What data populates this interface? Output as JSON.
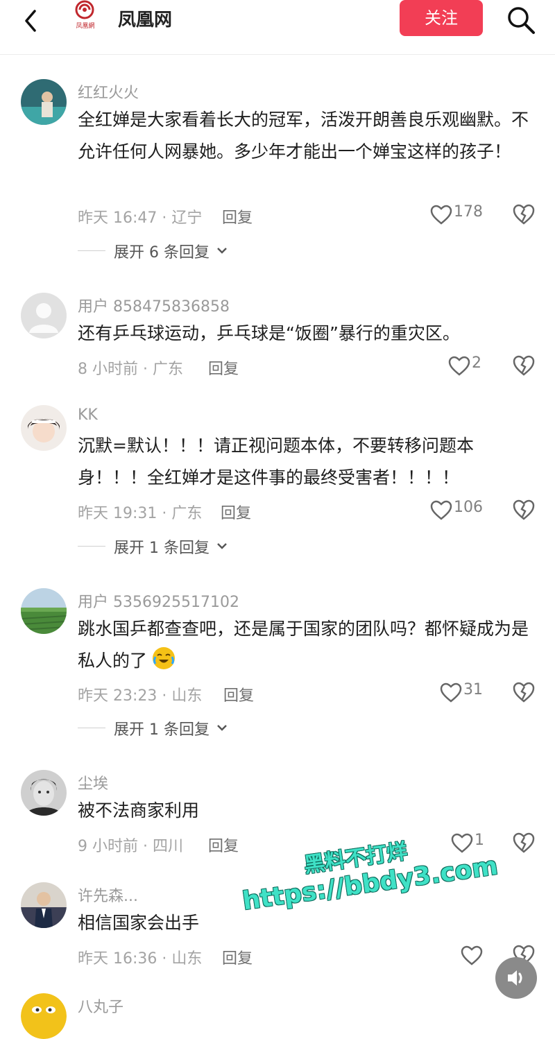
{
  "header": {
    "title": "凤凰网",
    "logo_text": "凤凰網",
    "follow_label": "关注"
  },
  "comments": [
    {
      "username": "红红火火",
      "text": "全红婵是大家看着长大的冠军，活泼开朗善良乐观幽默。不允许任何人网暴她。多少年才能出一个婵宝这样的孩子！",
      "time_location": "昨天 16:47 · 辽宁",
      "reply_label": "回复",
      "likes": "178",
      "expand_label": "展开 6 条回复"
    },
    {
      "username": "用户 858475836858",
      "text": "还有乒乓球运动，乒乓球是“饭圈”暴行的重灾区。",
      "time_location": "8 小时前 · 广东",
      "reply_label": "回复",
      "likes": "2"
    },
    {
      "username": "KK",
      "text": "沉默=默认！！！请正视问题本体，不要转移问题本身！！！全红婵才是这件事的最终受害者！！！！",
      "time_location": "昨天 19:31 · 广东",
      "reply_label": "回复",
      "likes": "106",
      "expand_label": "展开 1 条回复"
    },
    {
      "username": "用户 5356925517102",
      "text": "跳水国乒都查查吧，还是属于国家的团队吗？都怀疑成为是私人的了",
      "time_location": "昨天 23:23 · 山东",
      "reply_label": "回复",
      "likes": "31",
      "expand_label": "展开 1 条回复"
    },
    {
      "username": "尘埃",
      "text": "被不法商家利用",
      "time_location": "9 小时前 · 四川",
      "reply_label": "回复",
      "likes": "1"
    },
    {
      "username": "许先森...",
      "text": "相信国家会出手",
      "time_location": "昨天 16:36 · 山东",
      "reply_label": "回复",
      "likes": ""
    },
    {
      "username": "八丸子"
    }
  ],
  "watermark": {
    "line1": "黑料不打烊",
    "line2": "https://bbdy3.com"
  }
}
